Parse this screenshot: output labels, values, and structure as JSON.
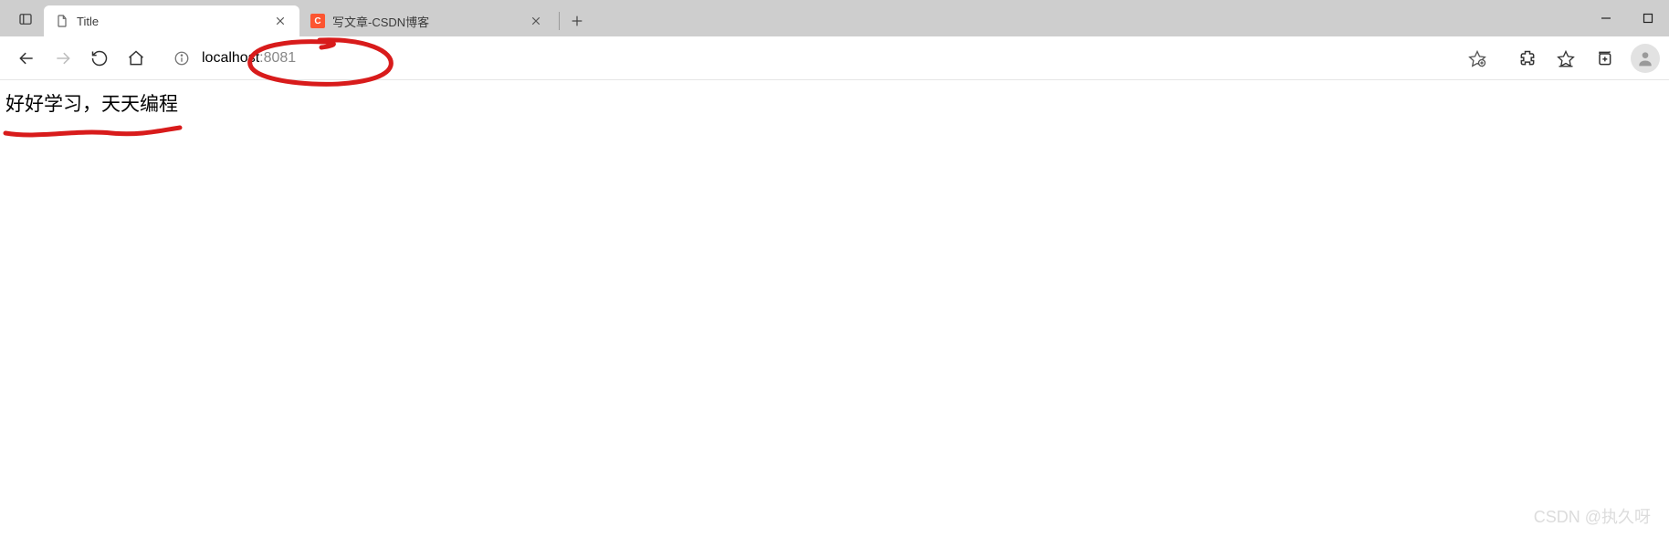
{
  "tabs": [
    {
      "title": "Title",
      "active": true
    },
    {
      "title": "写文章-CSDN博客",
      "favicon_text": "C",
      "active": false
    }
  ],
  "address": {
    "host": "localhost",
    "port": ":8081"
  },
  "page": {
    "text": "好好学习，天天编程"
  },
  "watermark": "CSDN @执久呀"
}
